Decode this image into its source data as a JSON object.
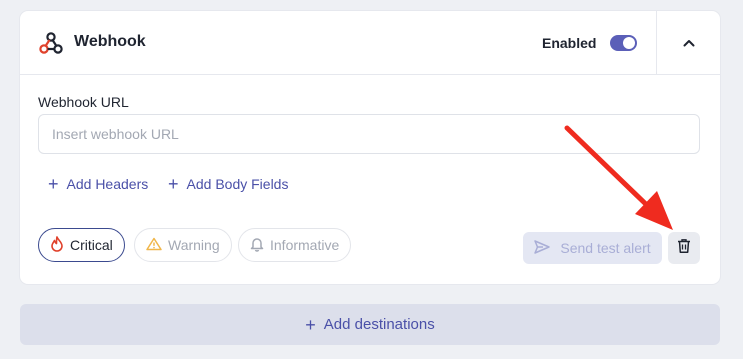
{
  "header": {
    "title": "Webhook",
    "icon": "webhook-icon",
    "enabled_label": "Enabled",
    "enabled": true,
    "collapse_icon": "chevron-up-icon"
  },
  "form": {
    "url_label": "Webhook URL",
    "url_placeholder": "Insert webhook URL",
    "url_value": "",
    "add_headers_label": "Add Headers",
    "add_body_fields_label": "Add Body Fields"
  },
  "severities": [
    {
      "label": "Critical",
      "icon": "flame-icon",
      "selected": true
    },
    {
      "label": "Warning",
      "icon": "warning-icon",
      "selected": false
    },
    {
      "label": "Informative",
      "icon": "bell-icon",
      "selected": false
    }
  ],
  "actions": {
    "send_test_label": "Send test alert",
    "send_test_icon": "send-icon",
    "delete_icon": "trash-icon"
  },
  "footer": {
    "add_destinations_label": "Add destinations"
  },
  "colors": {
    "accent": "#4a50a8",
    "toggle_on": "#5b5fb8",
    "critical": "#e0412b",
    "warning": "#f0b64a",
    "annotation_arrow": "#ef2b1f"
  }
}
